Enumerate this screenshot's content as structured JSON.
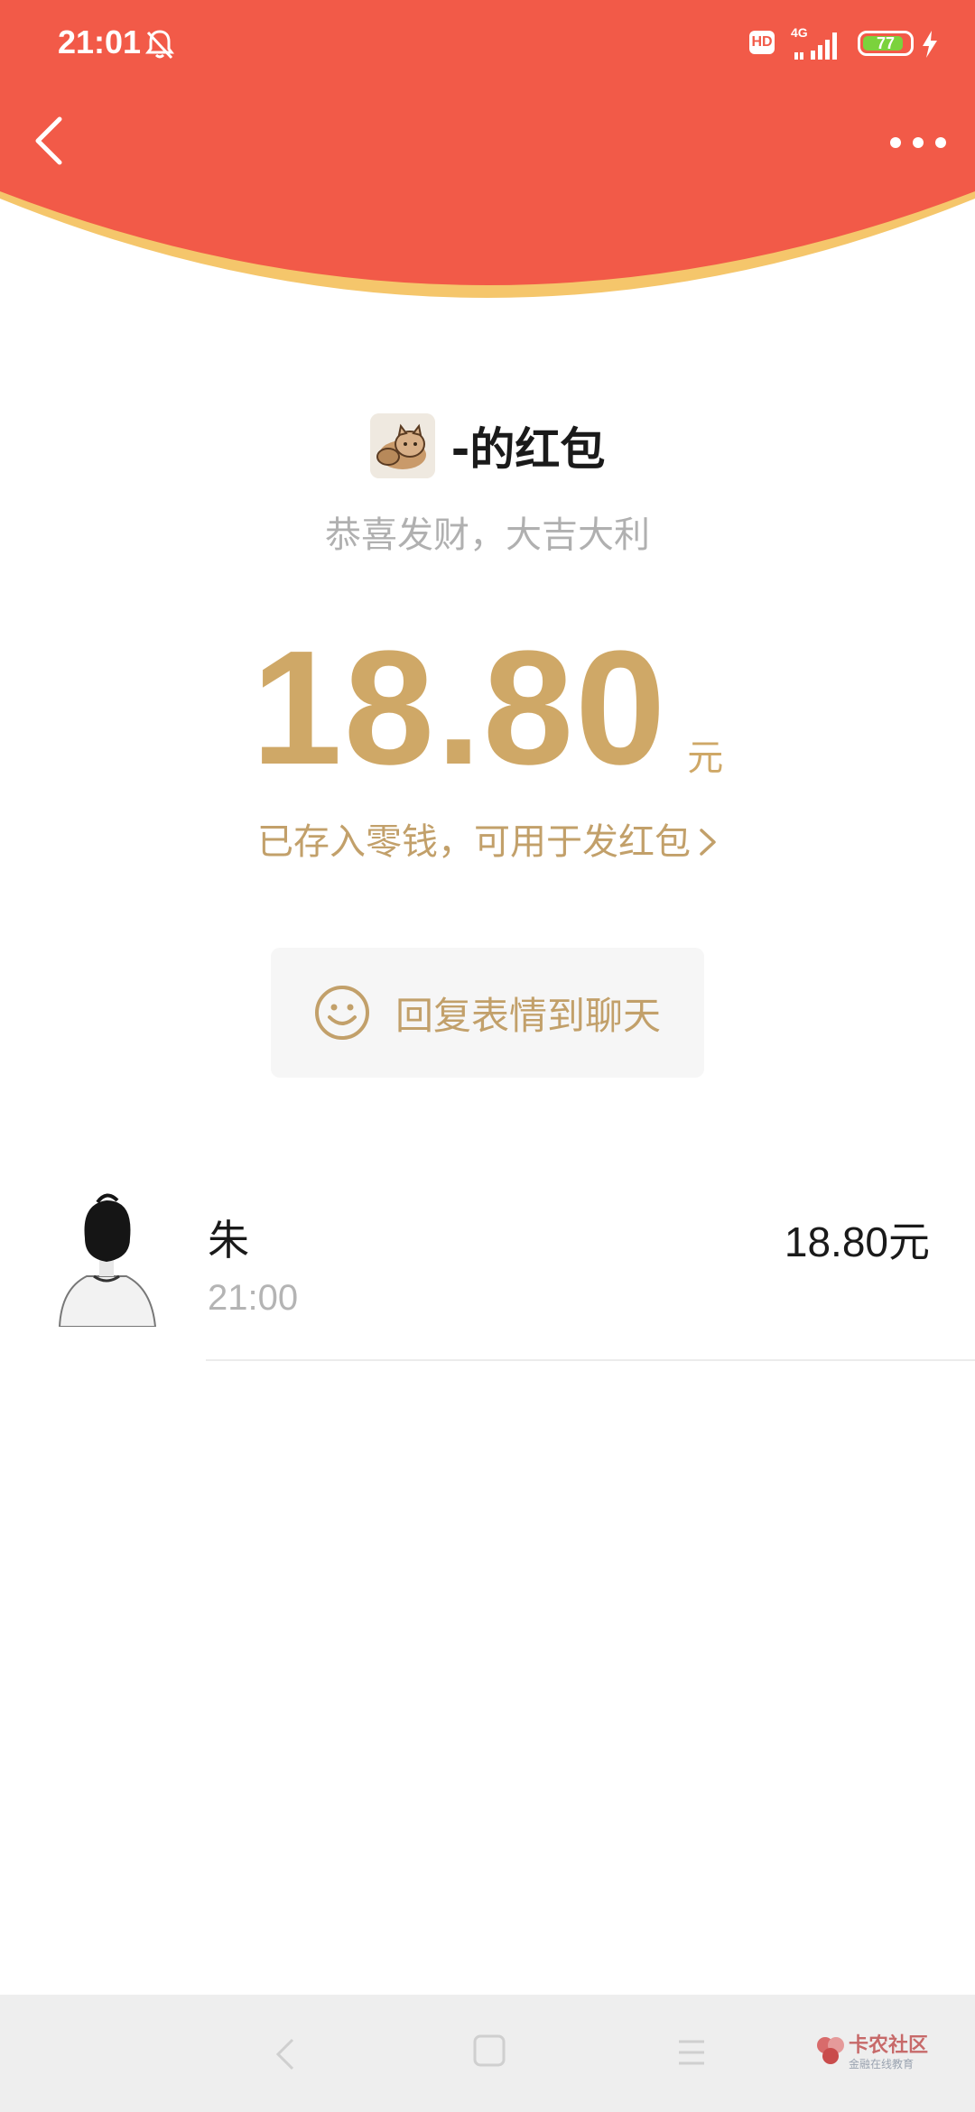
{
  "status_bar": {
    "time": "21:01",
    "hd_label": "HD",
    "network_label": "4G",
    "battery_level": "77",
    "icons": [
      "bell-off-icon",
      "signal-icon",
      "battery-icon",
      "charging-bolt-icon"
    ]
  },
  "colors": {
    "header_red": "#F25A48",
    "header_rim": "#F5C66B",
    "gold": "#CFA867",
    "gold_text": "#C2A06A",
    "gray_text": "#B0B0B0"
  },
  "nav": {
    "back_icon": "chevron-left-icon",
    "more_icon": "more-dots-icon"
  },
  "packet": {
    "sender_name": "-的红包",
    "greeting": "恭喜发财，大吉大利",
    "amount": "18.80",
    "unit": "元",
    "saved_text": "已存入零钱，可用于发红包",
    "reply_label": "回复表情到聊天"
  },
  "receivers": [
    {
      "name": "朱",
      "time": "21:00",
      "amount": "18.80元"
    }
  ],
  "watermark": {
    "title": "卡农社区",
    "subtitle": "金融在线教育"
  }
}
